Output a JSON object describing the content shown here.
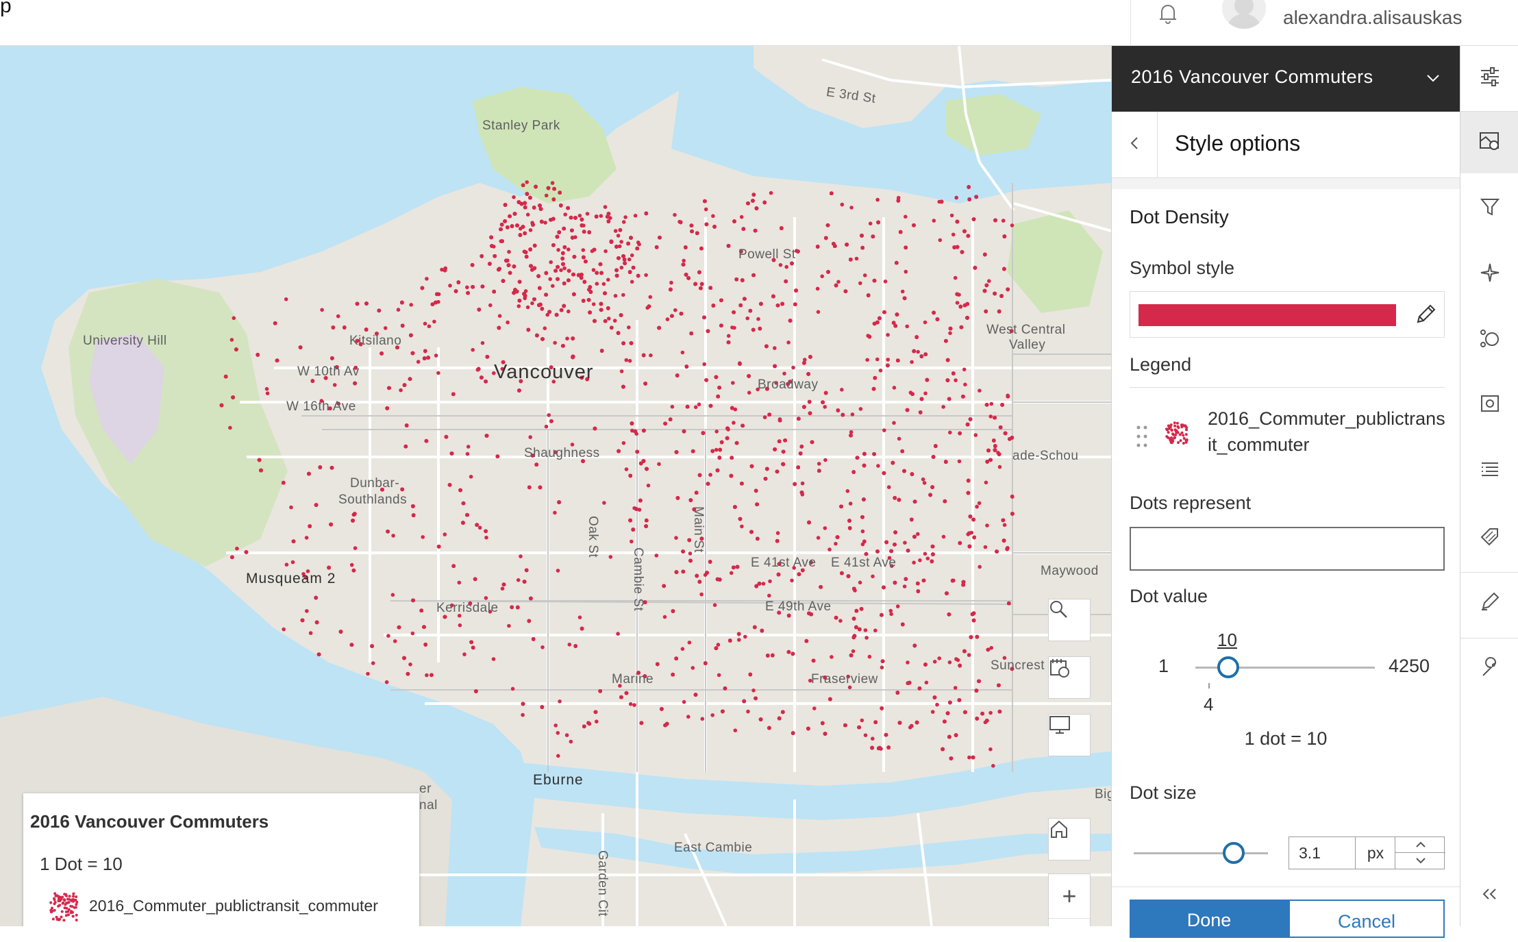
{
  "header": {
    "title_fragment": "p",
    "username": "alexandra.alisauskas"
  },
  "map": {
    "labels": {
      "stanley_park": "Stanley Park",
      "e3rd": "E 3rd St",
      "university_hill": "University Hill",
      "vancouver": "Vancouver",
      "w10": "W 10th Av",
      "w16": "W 16th Ave",
      "kitsilano": "Kitsilano",
      "shaughnessy": "Shaughness",
      "dunbar": "Dunbar-",
      "southlands": "Southlands",
      "musqueam": "Musqueam 2",
      "kerrisdale": "Kerrisdale",
      "oak": "Oak St",
      "cambie": "Cambie St",
      "main": "Main St",
      "powell": "Powell St",
      "west_central": "West Central",
      "valley": "Valley",
      "lade_schou": "ade-Schou",
      "maywood": "Maywood",
      "suncrest": "Suncrest",
      "eburne": "Eburne",
      "east_cambie": "East Cambie",
      "garden_city": "Garden Cit",
      "marine": "Marine",
      "fraserview": "Fraserview",
      "e41": "E 41st Ave",
      "e49": "E 49th Ave",
      "big": "Big",
      "er": "er",
      "nal": "nal",
      "broadway": "Broadway"
    },
    "dot_color": "#d5294b"
  },
  "legend_card": {
    "title": "2016 Vancouver Commuters",
    "dot_value_text": "1 Dot = 10",
    "layer_name": "2016_Commuter_publictransit_commuter"
  },
  "panel": {
    "layer_title": "2016 Vancouver Commuters",
    "subtitle": "Style options",
    "section": "Dot Density",
    "symbol_style_label": "Symbol style",
    "symbol_color": "#d5294b",
    "legend_label": "Legend",
    "legend_item": "2016_Commuter_publictransit_commuter",
    "dots_represent_label": "Dots represent",
    "dots_represent_value": "",
    "dot_value_label": "Dot value",
    "dot_value": {
      "min": "1",
      "max": "4250",
      "current": "10",
      "tick": "4",
      "caption": "1 dot = 10"
    },
    "dot_size_label": "Dot size",
    "dot_size_value": "3.1",
    "dot_size_unit": "px",
    "done": "Done",
    "cancel": "Cancel"
  }
}
